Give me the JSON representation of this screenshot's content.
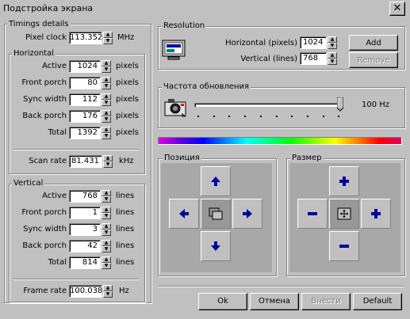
{
  "window": {
    "title": "Подстройка экрана",
    "close_glyph": "✕"
  },
  "timings": {
    "title": "Timings details",
    "pixel_clock": {
      "label": "Pixel clock",
      "value": "113.352",
      "unit": "MHz"
    },
    "horizontal": {
      "title": "Horizontal",
      "rows": [
        {
          "label": "Active",
          "value": "1024",
          "unit": "pixels"
        },
        {
          "label": "Front porch",
          "value": "80",
          "unit": "pixels"
        },
        {
          "label": "Sync width",
          "value": "112",
          "unit": "pixels"
        },
        {
          "label": "Back porch",
          "value": "176",
          "unit": "pixels"
        },
        {
          "label": "Total",
          "value": "1392",
          "unit": "pixels"
        }
      ],
      "scan_rate": {
        "label": "Scan rate",
        "value": "81.431",
        "unit": "kHz"
      }
    },
    "vertical": {
      "title": "Vertical",
      "rows": [
        {
          "label": "Active",
          "value": "768",
          "unit": "lines"
        },
        {
          "label": "Front porch",
          "value": "1",
          "unit": "lines"
        },
        {
          "label": "Sync width",
          "value": "3",
          "unit": "lines"
        },
        {
          "label": "Back porch",
          "value": "42",
          "unit": "lines"
        },
        {
          "label": "Total",
          "value": "814",
          "unit": "lines"
        }
      ],
      "frame_rate": {
        "label": "Frame rate",
        "value": "100.038",
        "unit": "Hz"
      }
    }
  },
  "resolution": {
    "title": "Resolution",
    "horizontal": {
      "label": "Horizontal (pixels)",
      "value": "1024"
    },
    "vertical": {
      "label": "Vertical (lines)",
      "value": "768"
    },
    "add_label": "Add",
    "remove_label": "Remove"
  },
  "refresh": {
    "title": "Частота обновления",
    "value_label": "100 Hz",
    "slider_fraction": 1.0
  },
  "position": {
    "title": "Позиция"
  },
  "size": {
    "title": "Размер"
  },
  "buttons": {
    "ok": "Ok",
    "cancel": "Отмена",
    "apply": "Внести",
    "default": "Default"
  },
  "colors": {
    "face": "#c0c0c0",
    "arrow": "#0000a0",
    "pad": "#a8a8a8"
  }
}
